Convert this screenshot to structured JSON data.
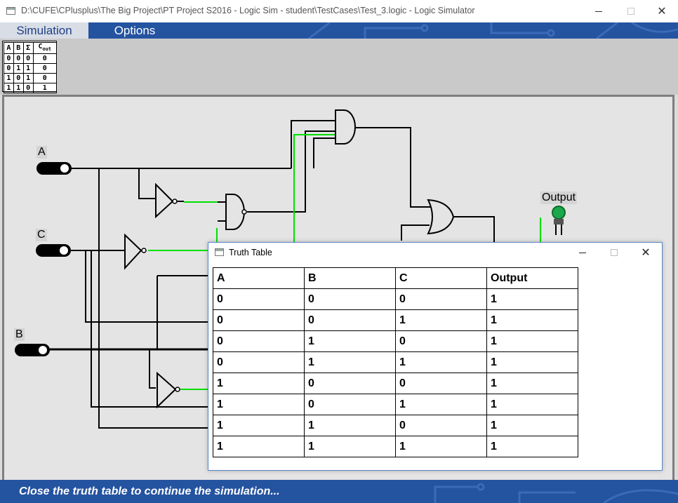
{
  "window": {
    "title": "D:\\CUFE\\CPlusplus\\The Big Project\\PT Project S2016 - Logic Sim - student\\TestCases\\Test_3.logic - Logic Simulator"
  },
  "menu": {
    "simulation": "Simulation",
    "options": "Options"
  },
  "adder_table": {
    "headers": [
      "A",
      "B",
      "Σ",
      "C"
    ],
    "header_sub": "out",
    "rows": [
      [
        "0",
        "0",
        "0",
        "0"
      ],
      [
        "0",
        "1",
        "1",
        "0"
      ],
      [
        "1",
        "0",
        "1",
        "0"
      ],
      [
        "1",
        "1",
        "0",
        "1"
      ]
    ]
  },
  "circuit": {
    "switches": [
      "A",
      "C",
      "B"
    ],
    "led_label": "Output",
    "colors": {
      "active_wire": "#00e000",
      "wire": "#000000",
      "led_on": "#1aa84a"
    }
  },
  "dialog": {
    "title": "Truth Table",
    "headers": [
      "A",
      "B",
      "C",
      "Output"
    ],
    "rows": [
      [
        "0",
        "0",
        "0",
        "1"
      ],
      [
        "0",
        "0",
        "1",
        "1"
      ],
      [
        "0",
        "1",
        "0",
        "1"
      ],
      [
        "0",
        "1",
        "1",
        "1"
      ],
      [
        "1",
        "0",
        "0",
        "1"
      ],
      [
        "1",
        "0",
        "1",
        "1"
      ],
      [
        "1",
        "1",
        "0",
        "1"
      ],
      [
        "1",
        "1",
        "1",
        "1"
      ]
    ]
  },
  "status": {
    "message": "Close the truth table to continue the simulation..."
  }
}
